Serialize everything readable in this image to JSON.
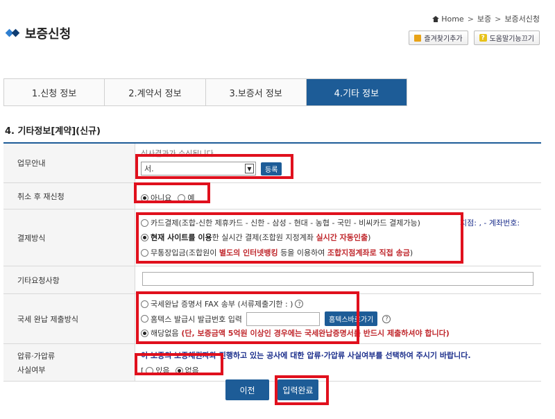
{
  "header": {
    "title": "보증신청",
    "breadcrumb": [
      "Home",
      "보증",
      "보증서신청"
    ],
    "bookmark_label": "즐겨찾기추가",
    "help_label": "도움말기능끄기"
  },
  "tabs": [
    {
      "label": "1.신청 정보",
      "active": false
    },
    {
      "label": "2.계약서 정보",
      "active": false
    },
    {
      "label": "3.보증서 정보",
      "active": false
    },
    {
      "label": "4.기타 정보",
      "active": true
    }
  ],
  "section_title": "4. 기타정보[계약](신규)",
  "form": {
    "guidance": {
      "label": "업무안내",
      "notice": "심사결과가 수신됩니다.",
      "select_value": "서.",
      "register_button": "등록"
    },
    "resubmit": {
      "label": "취소 후 재신청",
      "option_no": "아니요",
      "option_yes": "예",
      "selected": "no"
    },
    "payment": {
      "label": "결제방식",
      "option1": "카드결제(조합-신한 제휴카드 - 신한 - 삼성 - 현대 - 농협 - 국민 - 비씨카드 결제가능)",
      "side_note": "지점: , - 계좌번호:",
      "option2_bold": "현재 사이트를 이용",
      "option2_mid": "한 실시간 결제(조합원 지정계좌 ",
      "option2_red": "실시간 자동인출",
      "option2_end": ")",
      "option3_a": "무통장입금(조합원이 ",
      "option3_red1": "별도의 인터넷뱅킹",
      "option3_b": " 등을 이용하여 ",
      "option3_red2": "조합지점계좌로 직접 송금",
      "option3_c": ")"
    },
    "other_request": {
      "label": "기타요청사항",
      "value": ""
    },
    "tax": {
      "label": "국세 완납 제출방식",
      "option1": "국세완납 증명서 FAX 송부 (서류제출기한 : )",
      "option2": "홈텍스 발급시 발급번호 입력",
      "shortcut_button": "홈텍스바로가기",
      "option3_a": "해당없음",
      "option3_red": " (단, 보증금액 5억원 이상인 경우에는 국세완납증명서를 반드시 제출하셔야 합니다)"
    },
    "seizure": {
      "label_line1": "압류·가압류",
      "label_line2": "사실여부",
      "notice": "이 보증의 보증채권자와 진행하고 있는 공사에 대한 압류·가압류 사실여부를 선택하여 주시기 바랍니다.",
      "option_yes": "있음",
      "option_no": "없음",
      "selected": "no"
    }
  },
  "buttons": {
    "prev": "이전",
    "complete": "입력완료"
  },
  "colors": {
    "primary": "#1d5c97",
    "highlight": "#e0101d",
    "red_text": "#c0282d"
  }
}
